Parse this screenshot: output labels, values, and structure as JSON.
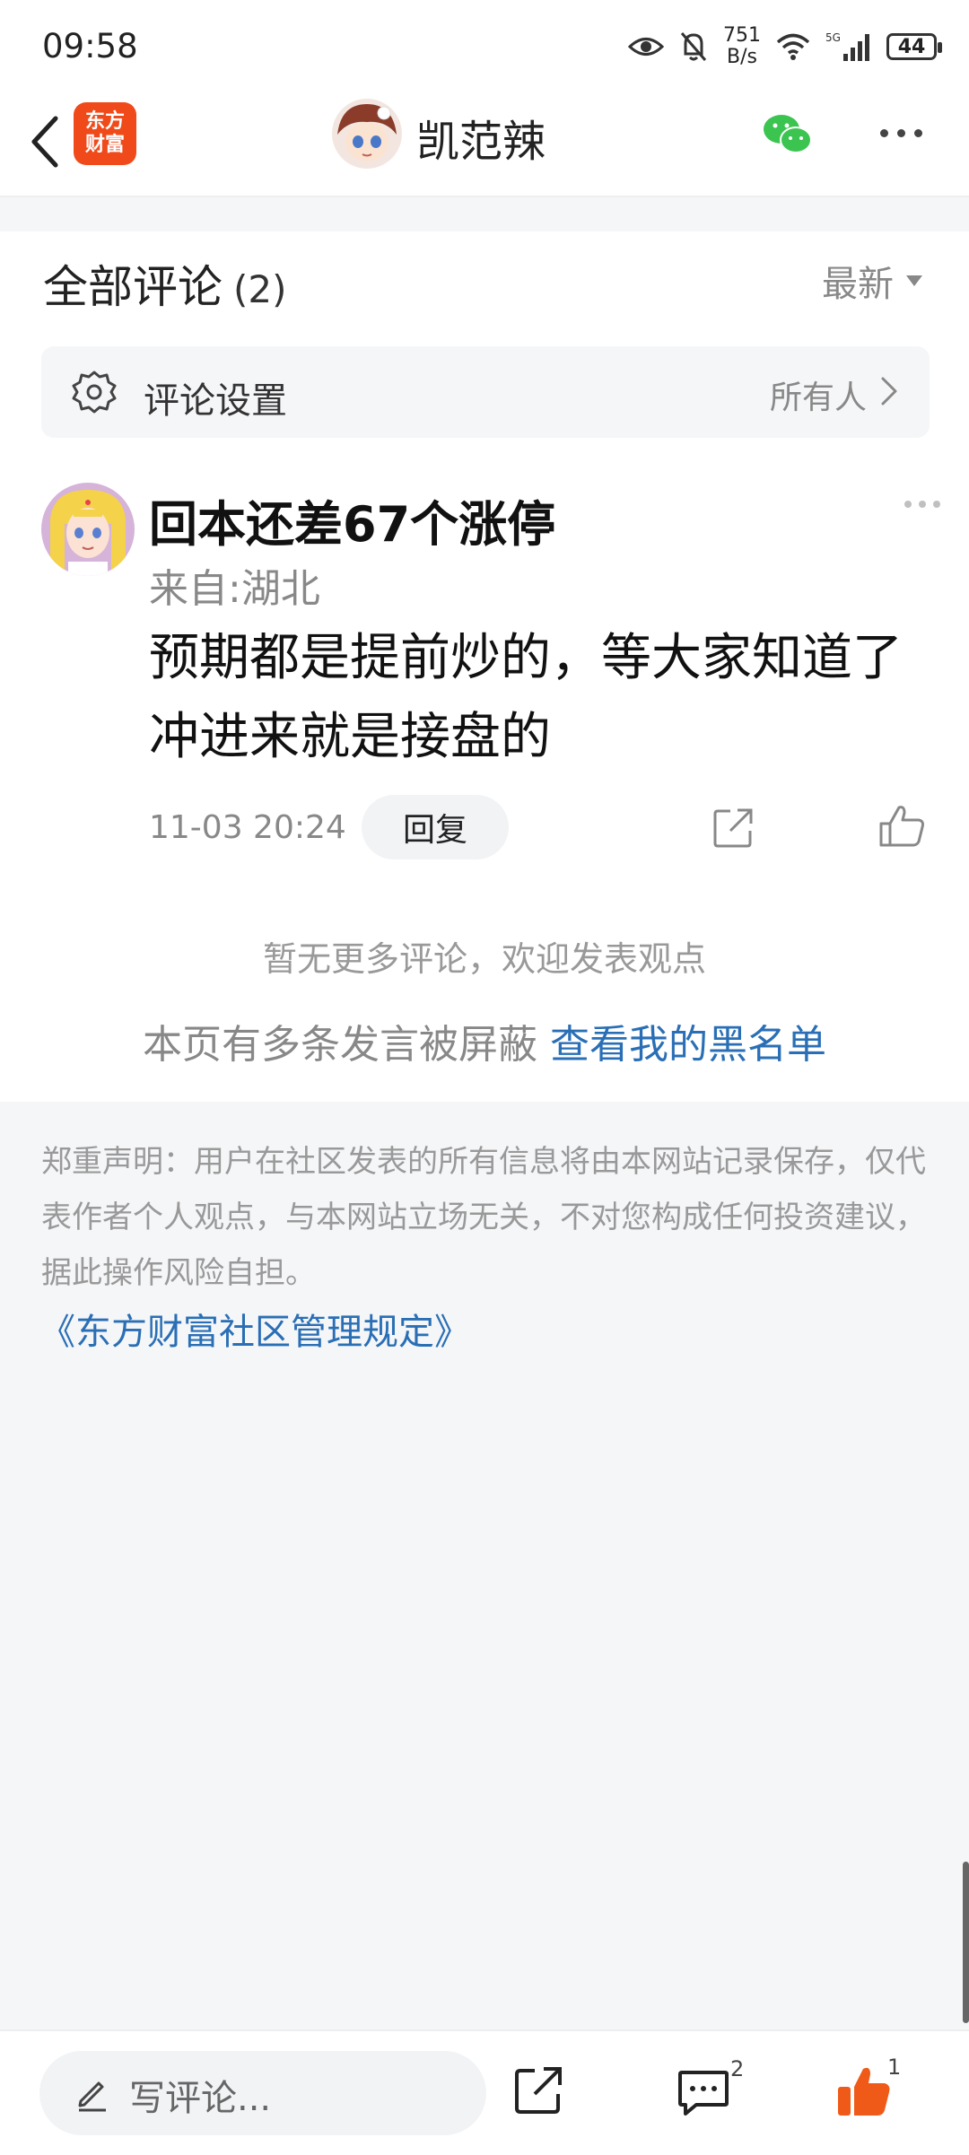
{
  "status_bar": {
    "time": "09:58",
    "net_speed_value": "751",
    "net_speed_unit": "B/s",
    "battery": "44",
    "icons": [
      "eye-icon",
      "bell-off-icon",
      "wifi-icon",
      "signal-5g-icon",
      "battery-icon"
    ]
  },
  "nav": {
    "app_logo_line1": "东方",
    "app_logo_line2": "财富",
    "title": "凯范辣",
    "icons": [
      "back-icon",
      "wechat-icon",
      "more-icon"
    ]
  },
  "comments_section": {
    "title": "全部评论",
    "count": "(2)",
    "sort_label": "最新",
    "settings_label": "评论设置",
    "settings_value": "所有人"
  },
  "comment": {
    "username": "回本还差67个涨停",
    "location": "来自:湖北",
    "text": "预期都是提前炒的，等大家知道了冲进来就是接盘的",
    "time": "11-03 20:24",
    "reply_label": "回复"
  },
  "footer_notes": {
    "no_more": "暂无更多评论，欢迎发表观点",
    "blocked_prefix": "本页有多条发言被屏蔽 ",
    "blocked_link": "查看我的黑名单"
  },
  "disclaimer": {
    "text": "郑重声明：用户在社区发表的所有信息将由本网站记录保存，仅代表作者个人观点，与本网站立场无关，不对您构成任何投资建议，据此操作风险自担。",
    "rules_link": "《东方财富社区管理规定》"
  },
  "bottom_bar": {
    "comment_placeholder": "写评论...",
    "comment_count": "2",
    "like_count": "1"
  },
  "colors": {
    "brand_orange": "#f04a1a",
    "link_blue": "#2a6fb5",
    "like_orange": "#f05a18",
    "wechat_green": "#3cc451"
  }
}
